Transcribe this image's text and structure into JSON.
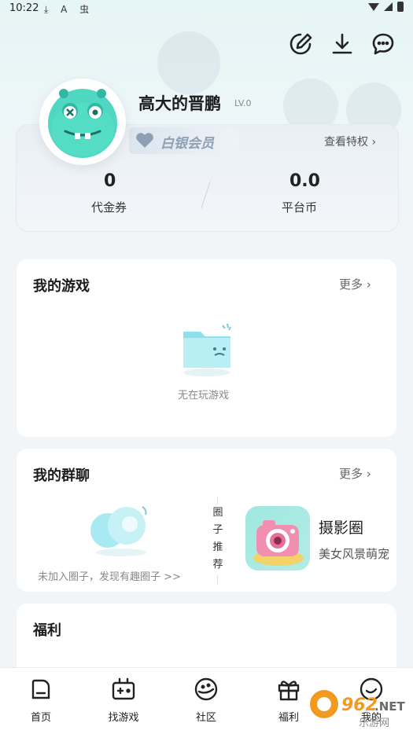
{
  "status_bar": {
    "time": "10:22",
    "icons": "⤓ A 虫"
  },
  "profile": {
    "username": "高大的晋鹏",
    "level": "LV.0",
    "membership": "白银会员",
    "view_privileges": "查看特权 ›",
    "stats": [
      {
        "value": "0",
        "label": "代金券"
      },
      {
        "value": "0.0",
        "label": "平台币"
      }
    ]
  },
  "my_games": {
    "title": "我的游戏",
    "more": "更多 ›",
    "empty_text": "无在玩游戏"
  },
  "my_groups": {
    "title": "我的群聊",
    "more": "更多 ›",
    "empty_text": "未加入圈子，发现有趣圈子 >>",
    "recommend_label": "圈子推荐",
    "recommended": {
      "name": "摄影圈",
      "desc": "美女风景萌宠"
    }
  },
  "welfare": {
    "title": "福利"
  },
  "bottom_nav": [
    {
      "label": "首页",
      "icon": "home-icon"
    },
    {
      "label": "找游戏",
      "icon": "gamepad-icon"
    },
    {
      "label": "社区",
      "icon": "planet-icon"
    },
    {
      "label": "福利",
      "icon": "gift-icon"
    },
    {
      "label": "我的",
      "icon": "profile-icon"
    }
  ],
  "watermark": {
    "brand": "962.NET",
    "sub": "乐游网"
  },
  "colors": {
    "accent_teal": "#5fd3c8",
    "silver": "#8ea0b3",
    "watermark_orange": "#f29a1f"
  }
}
